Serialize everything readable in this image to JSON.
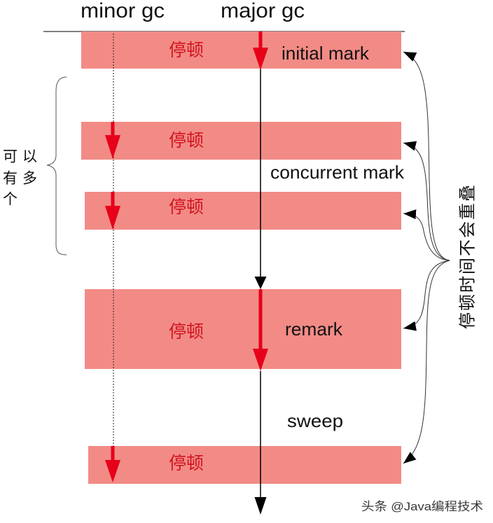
{
  "header": {
    "minor_gc_label": "minor gc",
    "major_gc_label": "major gc"
  },
  "pauses": [
    {
      "label": "停顿",
      "phase_label": "initial mark"
    },
    {
      "label": "停顿"
    },
    {
      "label": "停顿"
    },
    {
      "label": "停顿",
      "phase_label": "remark"
    },
    {
      "label": "停顿"
    }
  ],
  "concurrent_phases": {
    "concurrent_mark": "concurrent mark",
    "sweep": "sweep"
  },
  "left_annotation": {
    "lines": [
      "可以",
      "有多",
      "个"
    ]
  },
  "right_annotation": {
    "text": "停顿时间不会重叠"
  },
  "watermark": "头条 @Java编程技术",
  "colors": {
    "pause_fill": "#F28B86",
    "pause_text": "#D0141F",
    "gc_arrow": "#E6001A",
    "timeline": "#000000"
  }
}
